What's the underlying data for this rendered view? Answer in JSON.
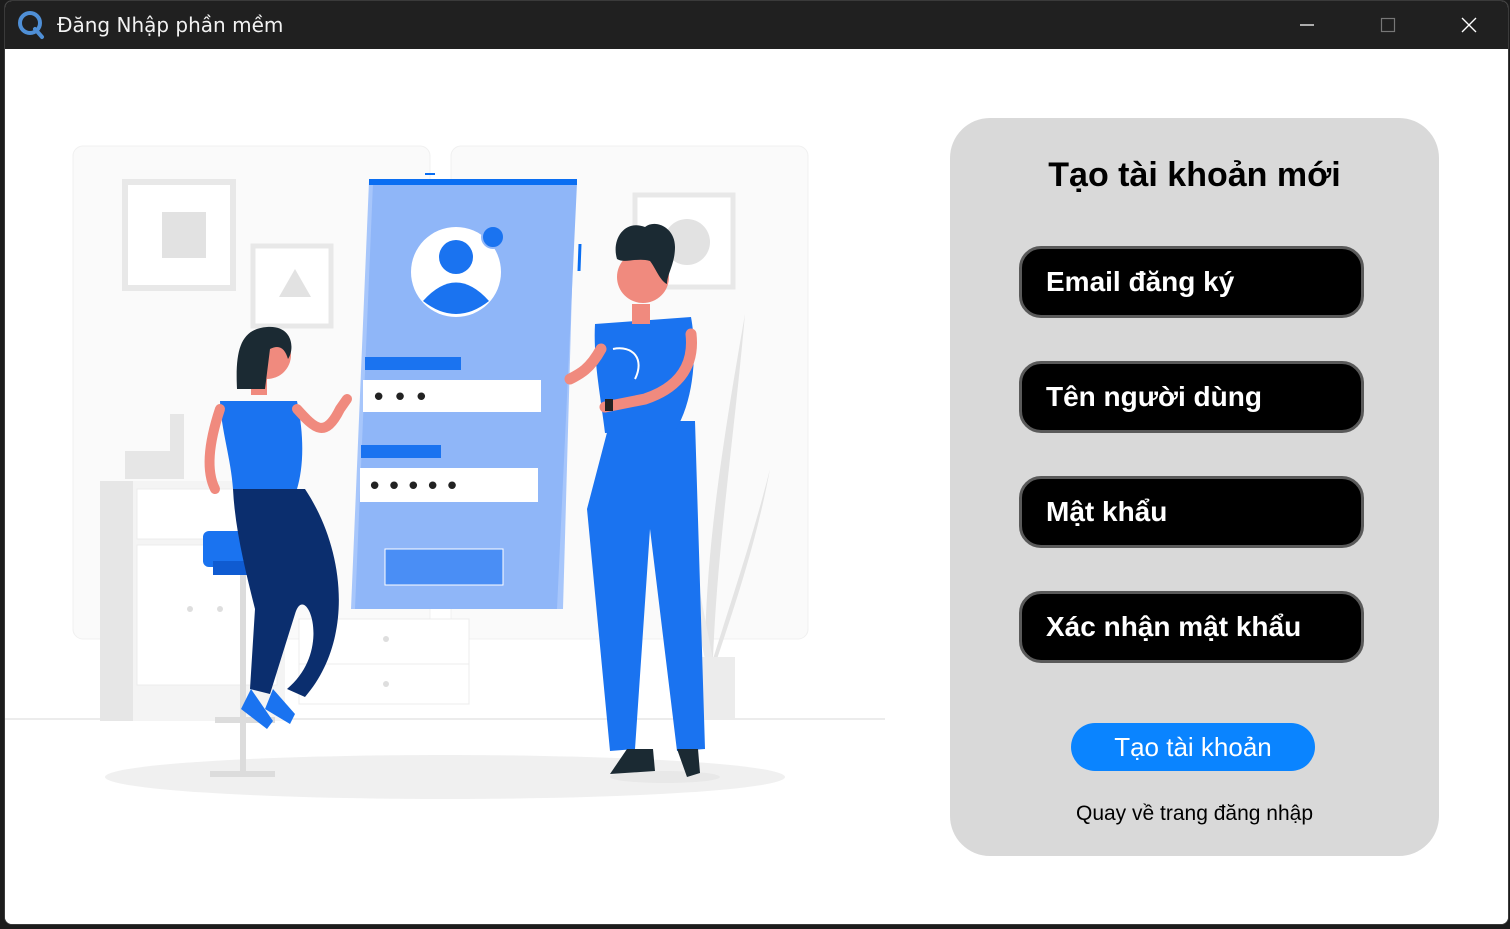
{
  "window": {
    "title": "Đăng Nhập phần mềm",
    "app_icon": "q-logo-icon",
    "controls": [
      "minimize-icon",
      "maximize-icon",
      "close-icon"
    ]
  },
  "illustration": {
    "description_icon": "sign-up-illustration",
    "password_mask_1": "•••",
    "password_mask_2": "•••••"
  },
  "form": {
    "title": "Tạo tài khoản mới",
    "email_placeholder": "Email đăng ký",
    "username_placeholder": "Tên người dùng",
    "password_placeholder": "Mật khẩu",
    "confirm_placeholder": "Xác nhận mật khẩu",
    "submit_label": "Tạo tài khoản",
    "back_link": "Quay về trang đăng nhập"
  },
  "colors": {
    "accent": "#0a84ff",
    "panel_bg": "#d9d9d9",
    "field_bg": "#000000",
    "titlebar_bg": "#202020"
  }
}
